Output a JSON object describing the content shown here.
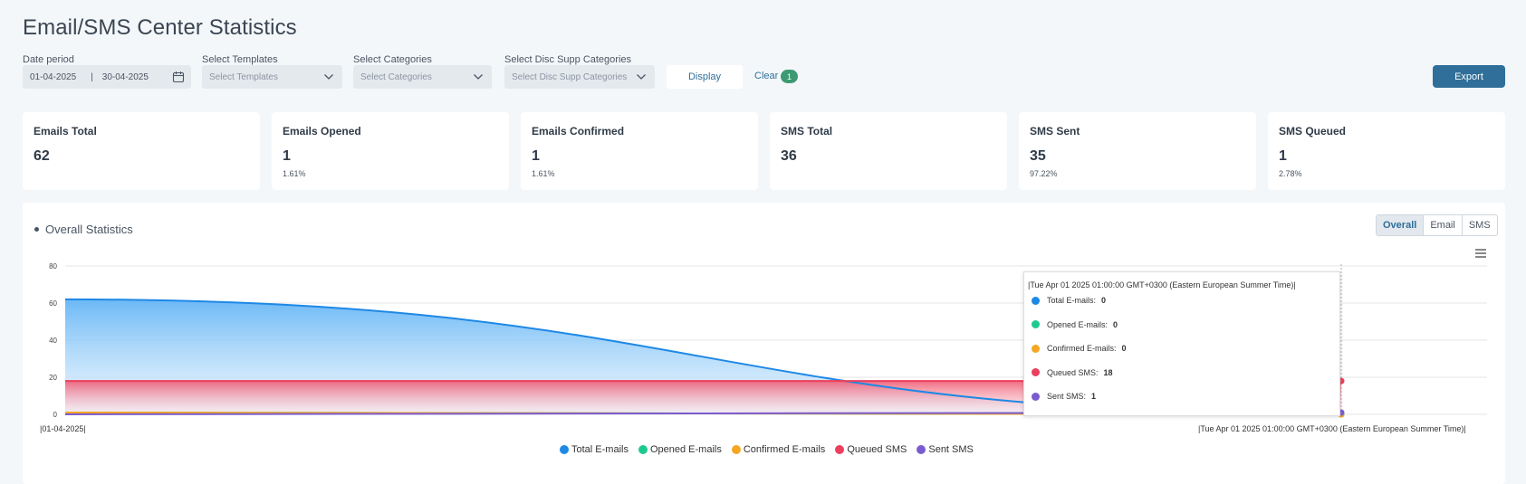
{
  "title": "Email/SMS Center Statistics",
  "filters": {
    "date_label": "Date period",
    "date_from": "01-04-2025",
    "date_sep": "|",
    "date_to": "30-04-2025",
    "templates_label": "Select Templates",
    "templates_placeholder": "Select Templates",
    "categories_label": "Select Categories",
    "categories_placeholder": "Select Categories",
    "disc_label": "Select Disc Supp Categories",
    "disc_placeholder": "Select Disc Supp Categories",
    "display_button": "Display",
    "clear_link": "Clear",
    "clear_count": "1",
    "export_button": "Export"
  },
  "cards": [
    {
      "label": "Emails Total",
      "value": "62",
      "pct": ""
    },
    {
      "label": "Emails Opened",
      "value": "1",
      "pct": "1.61%"
    },
    {
      "label": "Emails Confirmed",
      "value": "1",
      "pct": "1.61%"
    },
    {
      "label": "SMS Total",
      "value": "36",
      "pct": ""
    },
    {
      "label": "SMS Sent",
      "value": "35",
      "pct": "97.22%"
    },
    {
      "label": "SMS Queued",
      "value": "1",
      "pct": "2.78%"
    }
  ],
  "panel": {
    "title": "Overall Statistics",
    "tabs": [
      "Overall",
      "Email",
      "SMS"
    ]
  },
  "tooltip": {
    "title": "|Tue Apr 01 2025 01:00:00 GMT+0300 (Eastern European Summer Time)|",
    "rows": [
      {
        "label": "Total E-mails:",
        "value": "0",
        "color": "#1e88e5"
      },
      {
        "label": "Opened E-mails:",
        "value": "0",
        "color": "#1fc98e"
      },
      {
        "label": "Confirmed E-mails:",
        "value": "0",
        "color": "#f5a623"
      },
      {
        "label": "Queued SMS:",
        "value": "18",
        "color": "#ec3f5d"
      },
      {
        "label": "Sent SMS:",
        "value": "1",
        "color": "#7b5ccf"
      }
    ]
  },
  "chart_data": {
    "type": "area",
    "x": [
      "|01-04-2025|",
      "|Tue Apr 01 2025 01:00:00 GMT+0300 (Eastern European Summer Time)|"
    ],
    "ylim": [
      0,
      80
    ],
    "yticks": [
      "0",
      "20",
      "40",
      "60",
      "80"
    ],
    "grid": true,
    "legend_position": "bottom",
    "series": [
      {
        "name": "Total E-mails",
        "color": "#1e88e5",
        "values": [
          62,
          0
        ]
      },
      {
        "name": "Opened E-mails",
        "color": "#1fc98e",
        "values": [
          1,
          0
        ]
      },
      {
        "name": "Confirmed E-mails",
        "color": "#f5a623",
        "values": [
          1,
          0
        ]
      },
      {
        "name": "Queued SMS",
        "color": "#ec3f5d",
        "values": [
          18,
          18
        ]
      },
      {
        "name": "Sent SMS",
        "color": "#7b5ccf",
        "values": [
          0,
          1
        ]
      }
    ]
  }
}
